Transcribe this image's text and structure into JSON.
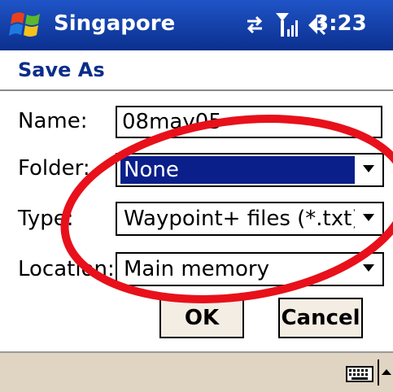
{
  "titlebar": {
    "app_name": "Singapore",
    "clock": "3:23",
    "icons": [
      "windows-logo-icon",
      "sync-arrows-icon",
      "signal-strength-icon",
      "speaker-icon"
    ]
  },
  "dialog": {
    "title": "Save As",
    "name_label": "Name:",
    "name_value": "08may05",
    "folder_label": "Folder:",
    "folder_value": "None",
    "type_label": "Type:",
    "type_value": "Waypoint+ files (*.txt)",
    "location_label": "Location:",
    "location_value": "Main memory",
    "ok_label": "OK",
    "cancel_label": "Cancel"
  },
  "colors": {
    "titlebar": "#0b2f8e",
    "selection": "#0a1f8a",
    "annotation": "#e8101a",
    "bottombar": "#e0d4c2"
  },
  "bottombar": {
    "icons": [
      "keyboard-icon",
      "up-arrow-icon"
    ]
  }
}
